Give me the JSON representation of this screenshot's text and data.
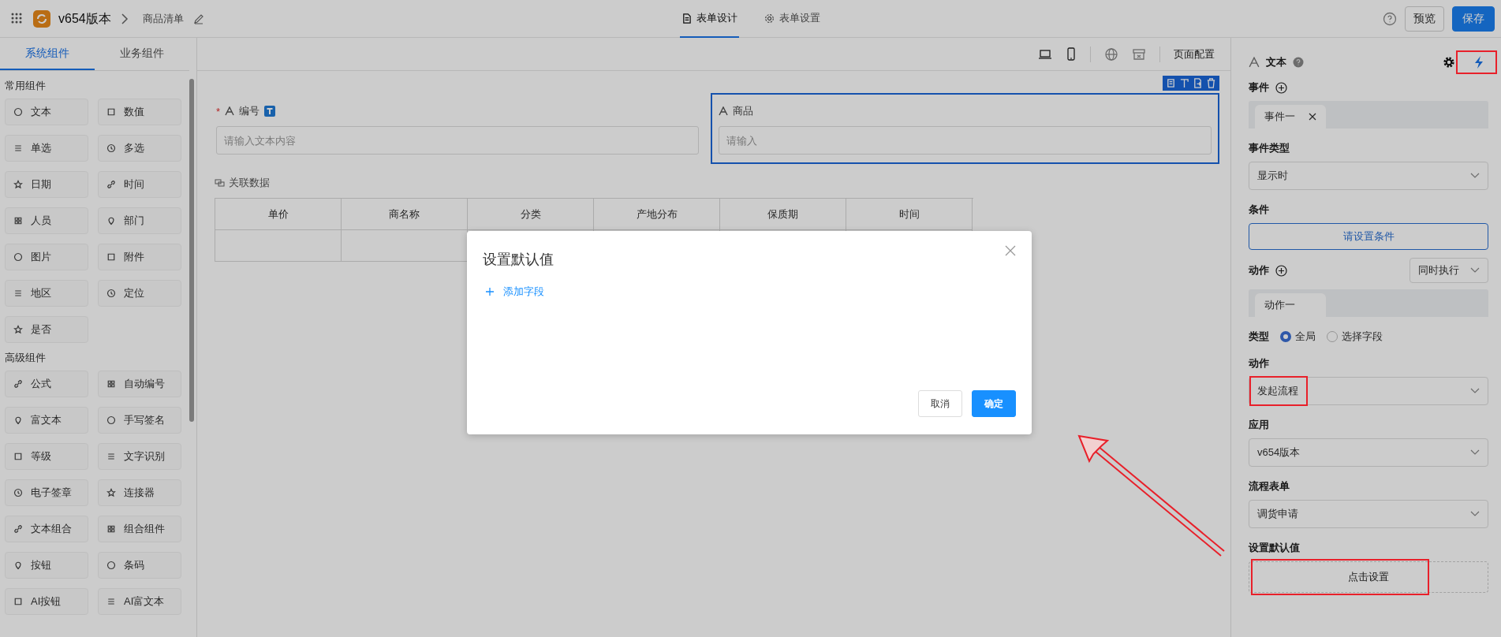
{
  "top_bar": {
    "app_name": "v654版本",
    "page_name": "商品清单",
    "tabs": [
      {
        "label": "表单设计",
        "selected": true
      },
      {
        "label": "表单设置",
        "selected": false
      }
    ],
    "buttons": [
      {
        "label": "预览",
        "kind": "default"
      },
      {
        "label": "保存",
        "kind": "primary"
      }
    ]
  },
  "sidebar": {
    "tabs": [
      {
        "label": "系统组件",
        "selected": true
      },
      {
        "label": "业务组件",
        "selected": false
      }
    ],
    "sections": [
      {
        "title": "常用组件",
        "items": [
          "文本",
          "数值",
          "单选",
          "多选",
          "日期",
          "时间",
          "人员",
          "部门",
          "图片",
          "附件",
          "地区",
          "定位",
          "是否"
        ]
      },
      {
        "title": "高级组件",
        "items": [
          "公式",
          "自动编号",
          "富文本",
          "手写签名",
          "等级",
          "文字识别",
          "电子签章",
          "连接器",
          "文本组合",
          "组合组件",
          "按钮",
          "条码",
          "AI按钮",
          "AI富文本"
        ]
      }
    ]
  },
  "canvas": {
    "toolbar_label": "页面配置",
    "fields": [
      {
        "label": "编号",
        "required_mark": "*",
        "placeholder": "请输入文本内容",
        "selected": false
      },
      {
        "label": "商品",
        "placeholder": "请输入",
        "selected": true
      }
    ],
    "related_data": {
      "title": "关联数据",
      "columns": [
        "单价",
        "商名称",
        "分类",
        "产地分布",
        "保质期",
        "时间"
      ]
    }
  },
  "dialog": {
    "title": "设置默认值",
    "add_link": "添加字段",
    "buttons": [
      {
        "label": "取消",
        "kind": "default"
      },
      {
        "label": "确定",
        "kind": "primary"
      }
    ]
  },
  "properties": {
    "title": "文本",
    "events_label": "事件",
    "event_tabs": [
      {
        "label": "事件一",
        "selected": true
      }
    ],
    "event_type": {
      "label": "事件类型",
      "value": "显示时"
    },
    "condition": {
      "label": "条件",
      "button": "请设置条件"
    },
    "actions_label": "动作",
    "actions_mode": "同时执行",
    "action_tabs": [
      {
        "label": "动作一",
        "selected": true
      }
    ],
    "type": {
      "label": "类型",
      "options": [
        {
          "label": "全局",
          "selected": true
        },
        {
          "label": "选择字段",
          "selected": false
        }
      ]
    },
    "selects": [
      {
        "label": "动作",
        "value": "发起流程"
      },
      {
        "label": "应用",
        "value": "v654版本"
      },
      {
        "label": "流程表单",
        "value": "调货申请"
      }
    ],
    "default_value": {
      "label": "设置默认值",
      "button": "点击设置"
    }
  }
}
